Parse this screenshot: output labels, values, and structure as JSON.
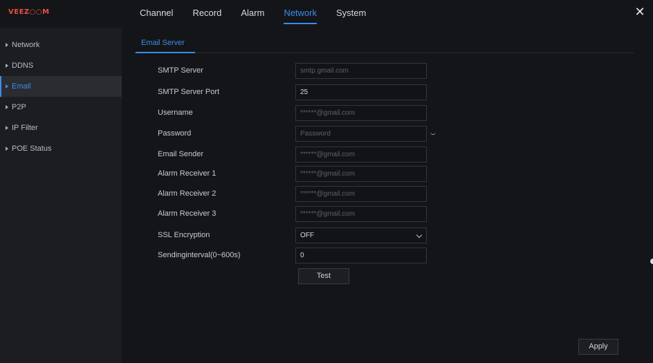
{
  "app": {
    "logo": "VEEZ○○M"
  },
  "topnav": {
    "tabs": [
      {
        "label": "Channel"
      },
      {
        "label": "Record"
      },
      {
        "label": "Alarm"
      },
      {
        "label": "Network",
        "active": true
      },
      {
        "label": "System"
      }
    ],
    "close_icon": "close-icon"
  },
  "sidebar": {
    "items": [
      {
        "label": "Network"
      },
      {
        "label": "DDNS"
      },
      {
        "label": "Email",
        "active": true
      },
      {
        "label": "P2P"
      },
      {
        "label": "IP Filter"
      },
      {
        "label": "POE Status"
      }
    ]
  },
  "email": {
    "subtab": "Email Server",
    "fields": [
      {
        "label": "SMTP Server",
        "value": "",
        "placeholder": "smtp.gmail.com"
      },
      {
        "label": "SMTP Server Port",
        "value": "25",
        "placeholder": ""
      },
      {
        "label": "Username",
        "value": "",
        "placeholder": "******@gmail.com"
      },
      {
        "label": "Password",
        "value": "",
        "placeholder": "Password"
      },
      {
        "label": "Email Sender",
        "value": "",
        "placeholder": "******@gmail.com"
      },
      {
        "label": "Alarm Receiver 1",
        "value": "",
        "placeholder": "******@gmail.com"
      },
      {
        "label": "Alarm Receiver 2",
        "value": "",
        "placeholder": "******@gmail.com"
      },
      {
        "label": "Alarm Receiver 3",
        "value": "",
        "placeholder": "******@gmail.com"
      },
      {
        "label": "SSL Encryption",
        "value": "OFF",
        "placeholder": ""
      },
      {
        "label": "Sendinginterval(0~600s)",
        "value": "0",
        "placeholder": ""
      }
    ],
    "test_label": "Test",
    "apply_label": "Apply"
  },
  "colors": {
    "accent": "#3b8eea",
    "brand": "#e8513f",
    "background": "#141518",
    "sidebar": "#1c1d21"
  }
}
